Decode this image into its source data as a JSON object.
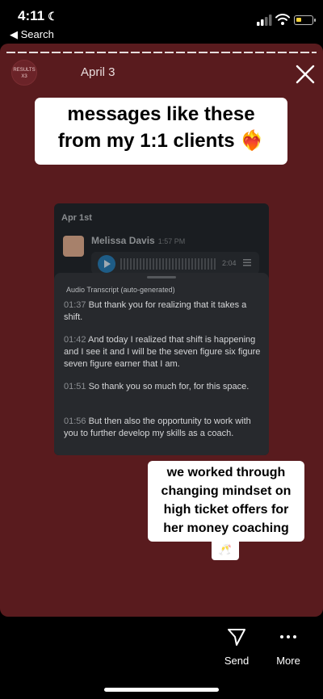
{
  "status_bar": {
    "time": "4:11",
    "back_label": "◀ Search"
  },
  "story": {
    "avatar_text_line1": "RESULTS",
    "avatar_text_line2": "X3",
    "date": "April 3",
    "headline": {
      "line1": "messages like these",
      "line2": "from my 1:1 clients ❤️‍🔥"
    },
    "slack": {
      "date_label": "Apr 1st",
      "sender": "Melissa Davis",
      "sender_time": "1:57 PM",
      "audio_duration": "2:04",
      "transcript_title": "Audio Transcript (auto-generated)",
      "transcript": [
        {
          "ts": "01:37",
          "text": "But thank you for realizing that it takes a shift."
        },
        {
          "ts": "01:42",
          "text": "And today I realized that shift is happening and I see it and I will be the seven figure six figure seven figure earner that I am."
        },
        {
          "ts": "01:51",
          "text": "So thank you so much for, for this space."
        },
        {
          "ts": "01:56",
          "text": "But then also the opportunity to work with you to further develop my skills as a coach."
        }
      ]
    },
    "caption": {
      "line1": "we worked through",
      "line2": "changing mindset on",
      "line3": "high ticket offers for",
      "line4": "her money coaching",
      "emoji": "🥂"
    }
  },
  "actions": {
    "send_label": "Send",
    "more_label": "More"
  },
  "colors": {
    "story_background": "#591b1e",
    "battery_fill": "#f2d13a"
  }
}
